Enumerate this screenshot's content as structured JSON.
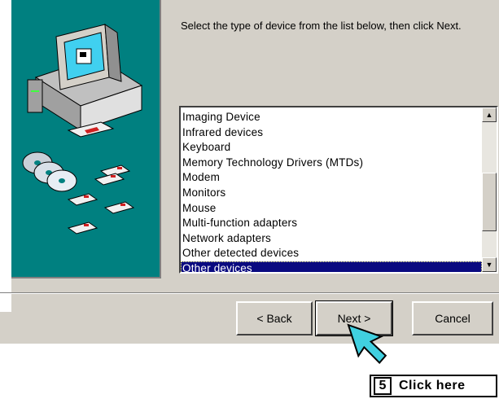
{
  "instruction": "Select the type of device from the list below, then click Next.",
  "device_list": {
    "items": [
      "Imaging Device",
      "Infrared devices",
      "Keyboard",
      "Memory Technology Drivers (MTDs)",
      "Modem",
      "Monitors",
      "Mouse",
      "Multi-function adapters",
      "Network adapters",
      "Other detected devices",
      "Other devices"
    ],
    "selected": "Other devices"
  },
  "buttons": {
    "back": "< Back",
    "next": "Next >",
    "cancel": "Cancel"
  },
  "callout": {
    "step": "5",
    "text": "Click here"
  },
  "colors": {
    "dialog_bg": "#d4d0c8",
    "art_bg": "#008080",
    "selection": "#0a0a80",
    "cursor": "#40d0e0"
  }
}
